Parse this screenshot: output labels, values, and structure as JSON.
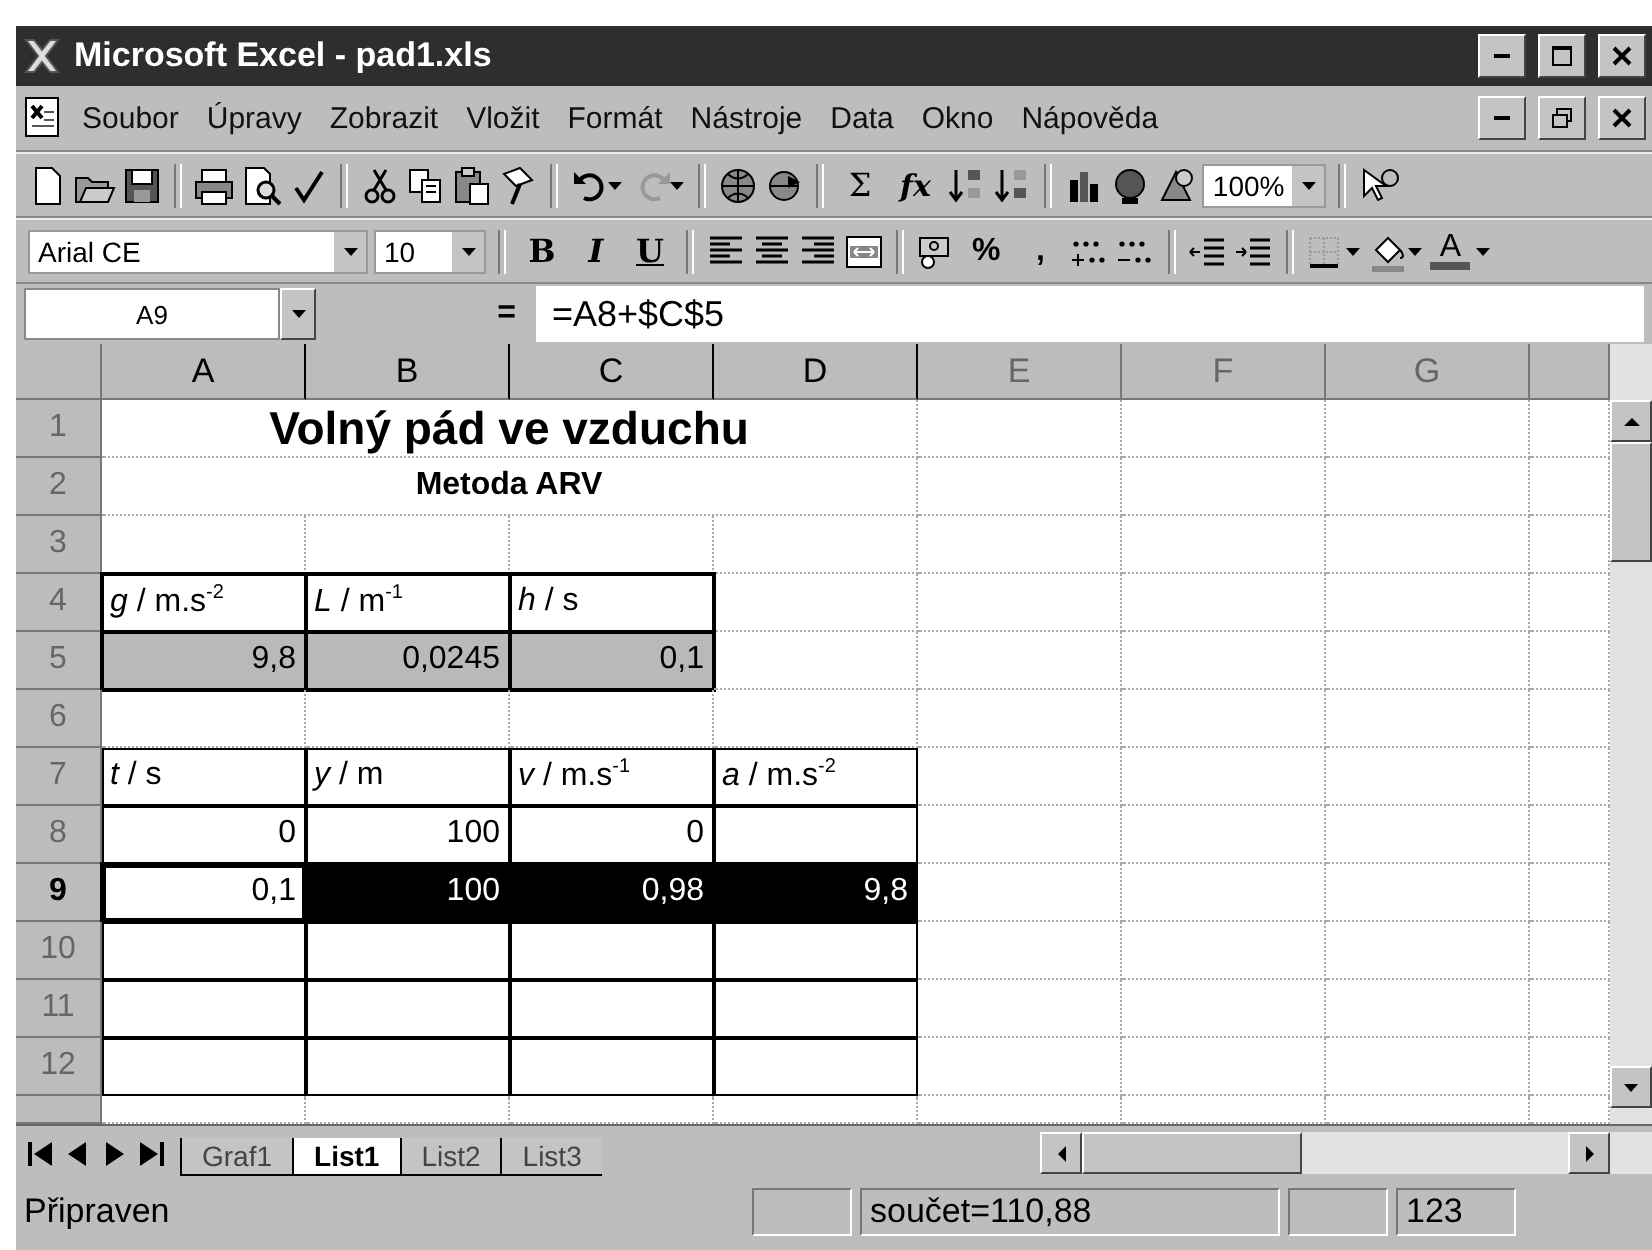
{
  "window": {
    "title": "Microsoft Excel - pad1.xls"
  },
  "menu": {
    "items": [
      {
        "label": "Soubor"
      },
      {
        "label": "Úpravy"
      },
      {
        "label": "Zobrazit"
      },
      {
        "label": "Vložit"
      },
      {
        "label": "Formát"
      },
      {
        "label": "Nástroje"
      },
      {
        "label": "Data"
      },
      {
        "label": "Okno"
      },
      {
        "label": "Nápověda"
      }
    ]
  },
  "standard_toolbar": {
    "sum_button": "Σ",
    "function_button": "fx",
    "zoom": "100%"
  },
  "formatting_toolbar": {
    "font": "Arial CE",
    "size": "10",
    "bold_button": "B",
    "italic_button": "I",
    "underline_button": "U",
    "percent_button": "%",
    "comma_button": ",",
    "font_color_button": "A"
  },
  "formula_bar": {
    "name_box": "A9",
    "equals": "=",
    "formula": "=A8+$C$5"
  },
  "sheet": {
    "columns": [
      {
        "label": "A",
        "highlighted": true
      },
      {
        "label": "B",
        "highlighted": true
      },
      {
        "label": "C",
        "highlighted": true
      },
      {
        "label": "D",
        "highlighted": true
      },
      {
        "label": "E",
        "highlighted": false
      },
      {
        "label": "F",
        "highlighted": false
      },
      {
        "label": "G",
        "highlighted": false
      }
    ],
    "rows": [
      {
        "label": "1",
        "highlighted": false,
        "cells": [
          {
            "kind": "title",
            "text": "Volný pád ve vzduchu",
            "outlined": false,
            "selected": false,
            "active": false
          }
        ]
      },
      {
        "label": "2",
        "highlighted": false,
        "cells": [
          {
            "kind": "subtitle",
            "text": "Metoda ARV",
            "outlined": false,
            "selected": false,
            "active": false
          }
        ]
      },
      {
        "label": "3",
        "highlighted": false
      },
      {
        "label": "4",
        "highlighted": false,
        "cells": [
          {
            "kind": "header",
            "text": "*g* / m.s$^{-2}$",
            "outlined": true,
            "bold_outline": true,
            "selected": false,
            "active": false
          },
          {
            "kind": "header",
            "text": "*L* / m$^{-1}$",
            "outlined": true,
            "bold_outline": true,
            "selected": false,
            "active": false
          },
          {
            "kind": "header",
            "text": "*h* / s",
            "outlined": true,
            "bold_outline": true,
            "selected": false,
            "active": false
          }
        ]
      },
      {
        "label": "5",
        "highlighted": false,
        "cells": [
          {
            "kind": "input",
            "text": "9,8",
            "outlined": true,
            "bold_outline": true,
            "selected": false,
            "active": false
          },
          {
            "kind": "input",
            "text": "0,0245",
            "outlined": true,
            "bold_outline": true,
            "selected": false,
            "active": false
          },
          {
            "kind": "input",
            "text": "0,1",
            "outlined": true,
            "bold_outline": true,
            "selected": false,
            "active": false
          }
        ]
      },
      {
        "label": "6",
        "highlighted": false
      },
      {
        "label": "7",
        "highlighted": false,
        "cells": [
          {
            "kind": "header",
            "text": "*t* / s",
            "outlined": true,
            "bold_outline": false,
            "selected": false,
            "active": false
          },
          {
            "kind": "header",
            "text": "*y* / m",
            "outlined": true,
            "bold_outline": false,
            "selected": false,
            "active": false
          },
          {
            "kind": "header",
            "text": "*v* / m.s$^{-1}$",
            "outlined": true,
            "bold_outline": false,
            "selected": false,
            "active": false
          },
          {
            "kind": "header",
            "text": "*a* / m.s$^{-2}$",
            "outlined": true,
            "bold_outline": false,
            "selected": false,
            "active": false
          }
        ]
      },
      {
        "label": "8",
        "highlighted": false,
        "cells": [
          {
            "kind": "value",
            "text": "0",
            "outlined": true,
            "bold_outline": false,
            "selected": false,
            "active": false
          },
          {
            "kind": "value",
            "text": "100",
            "outlined": true,
            "bold_outline": false,
            "selected": false,
            "active": false
          },
          {
            "kind": "value",
            "text": "0",
            "outlined": true,
            "bold_outline": false,
            "selected": false,
            "active": false
          },
          {
            "kind": "value",
            "outlined": true,
            "bold_outline": false,
            "selected": false,
            "active": false
          }
        ]
      },
      {
        "label": "9",
        "highlighted": true,
        "cells": [
          {
            "kind": "value",
            "text": "0,1",
            "outlined": true,
            "bold_outline": false,
            "selected": true,
            "active": true
          },
          {
            "kind": "value",
            "text": "100",
            "outlined": true,
            "bold_outline": false,
            "selected": true,
            "active": false
          },
          {
            "kind": "value",
            "text": "0,98",
            "outlined": true,
            "bold_outline": false,
            "selected": true,
            "active": false
          },
          {
            "kind": "value",
            "text": "9,8",
            "outlined": true,
            "bold_outline": false,
            "selected": true,
            "active": false
          }
        ]
      },
      {
        "label": "10",
        "highlighted": false,
        "cells": [
          {
            "kind": "value",
            "outlined": true,
            "bold_outline": false,
            "selected": false,
            "active": false
          },
          {
            "kind": "value",
            "outlined": true,
            "bold_outline": false,
            "selected": false,
            "active": false
          },
          {
            "kind": "value",
            "outlined": true,
            "bold_outline": false,
            "selected": false,
            "active": false
          },
          {
            "kind": "value",
            "outlined": true,
            "bold_outline": false,
            "selected": false,
            "active": false
          }
        ]
      },
      {
        "label": "11",
        "highlighted": false,
        "cells": [
          {
            "kind": "value",
            "outlined": true,
            "bold_outline": false,
            "selected": false,
            "active": false
          },
          {
            "kind": "value",
            "outlined": true,
            "bold_outline": false,
            "selected": false,
            "active": false
          },
          {
            "kind": "value",
            "outlined": true,
            "bold_outline": false,
            "selected": false,
            "active": false
          },
          {
            "kind": "value",
            "outlined": true,
            "bold_outline": false,
            "selected": false,
            "active": false
          }
        ]
      },
      {
        "label": "12",
        "highlighted": false,
        "cells": [
          {
            "kind": "value",
            "outlined": true,
            "bold_outline": false,
            "selected": false,
            "active": false
          },
          {
            "kind": "value",
            "outlined": true,
            "bold_outline": false,
            "selected": false,
            "active": false
          },
          {
            "kind": "value",
            "outlined": true,
            "bold_outline": false,
            "selected": false,
            "active": false
          },
          {
            "kind": "value",
            "outlined": true,
            "bold_outline": false,
            "selected": false,
            "active": false
          }
        ]
      }
    ]
  },
  "sheet_tabs": [
    {
      "label": "Graf1",
      "selected": false
    },
    {
      "label": "List1",
      "selected": true
    },
    {
      "label": "List2",
      "selected": false
    },
    {
      "label": "List3",
      "selected": false
    }
  ],
  "status_bar": {
    "mode": "Připraven",
    "sum": "součet=110,88",
    "indicator": "123"
  }
}
